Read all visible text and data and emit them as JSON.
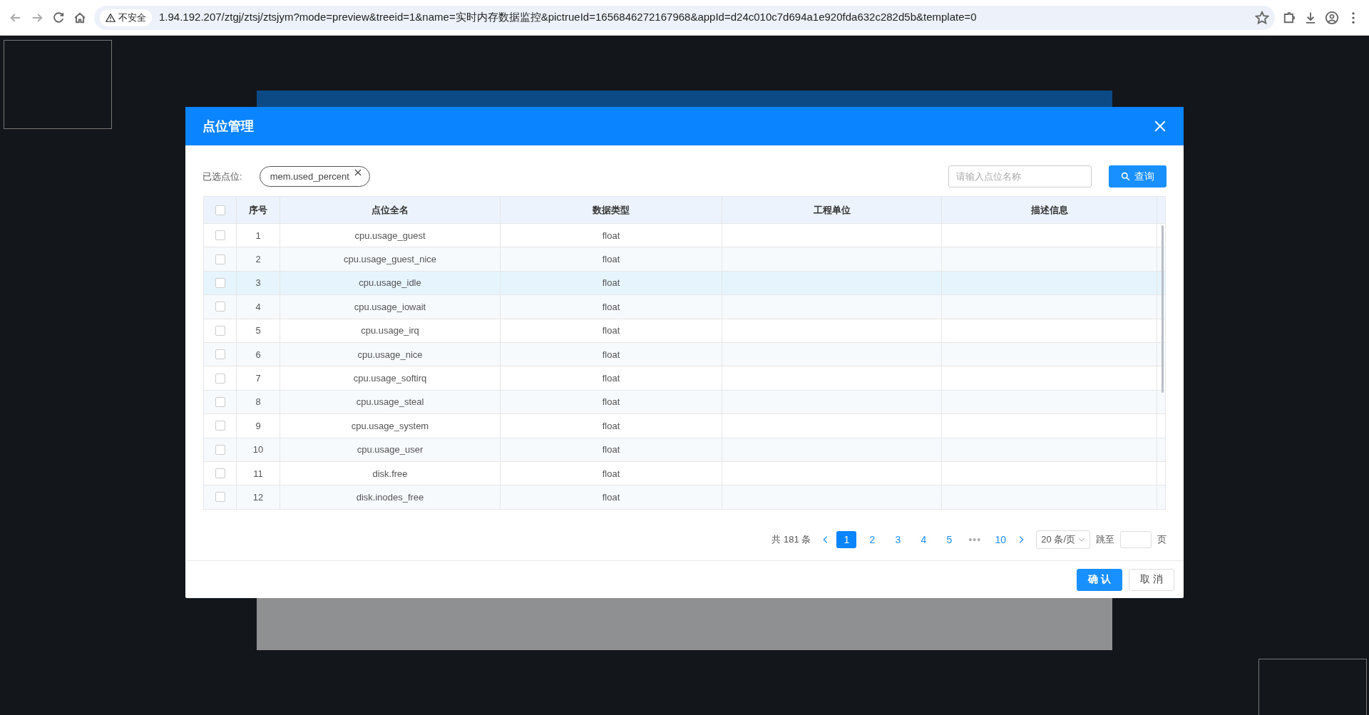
{
  "browser": {
    "security_label": "不安全",
    "url": "1.94.192.207/ztgj/ztsj/ztsjym?mode=preview&treeid=1&name=实时内存数据监控&pictrueId=1656846272167968&appId=d24c010c7d694a1e920fda632c282d5b&template=0"
  },
  "dialog": {
    "title": "点位管理",
    "selected_label": "已选点位:",
    "selected_tags": [
      {
        "label": "mem.used_percent"
      }
    ],
    "search": {
      "placeholder": "请输入点位名称"
    },
    "search_button": "查询",
    "table": {
      "all_checked": false,
      "columns": [
        "序号",
        "点位全名",
        "数据类型",
        "工程单位",
        "描述信息"
      ],
      "rows": [
        {
          "checked": false,
          "highlighted": false,
          "cells": [
            "1",
            "cpu.usage_guest",
            "float"
          ]
        },
        {
          "checked": false,
          "highlighted": false,
          "cells": [
            "2",
            "cpu.usage_guest_nice",
            "float"
          ]
        },
        {
          "checked": false,
          "highlighted": true,
          "cells": [
            "3",
            "cpu.usage_idle",
            "float"
          ]
        },
        {
          "checked": false,
          "highlighted": false,
          "cells": [
            "4",
            "cpu.usage_iowait",
            "float"
          ]
        },
        {
          "checked": false,
          "highlighted": false,
          "cells": [
            "5",
            "cpu.usage_irq",
            "float"
          ]
        },
        {
          "checked": false,
          "highlighted": false,
          "cells": [
            "6",
            "cpu.usage_nice",
            "float"
          ]
        },
        {
          "checked": false,
          "highlighted": false,
          "cells": [
            "7",
            "cpu.usage_softirq",
            "float"
          ]
        },
        {
          "checked": false,
          "highlighted": false,
          "cells": [
            "8",
            "cpu.usage_steal",
            "float"
          ]
        },
        {
          "checked": false,
          "highlighted": false,
          "cells": [
            "9",
            "cpu.usage_system",
            "float"
          ]
        },
        {
          "checked": false,
          "highlighted": false,
          "cells": [
            "10",
            "cpu.usage_user",
            "float"
          ]
        },
        {
          "checked": false,
          "highlighted": false,
          "cells": [
            "11",
            "disk.free",
            "float"
          ]
        },
        {
          "checked": false,
          "highlighted": false,
          "cells": [
            "12",
            "disk.inodes_free",
            "float"
          ]
        }
      ]
    },
    "pagination": {
      "total": "共 181 条",
      "pages": [
        {
          "label": "1",
          "selected": true
        },
        {
          "label": "2",
          "selected": false
        },
        {
          "label": "3",
          "selected": false
        },
        {
          "label": "4",
          "selected": false
        },
        {
          "label": "5",
          "selected": false
        },
        {
          "label": "•••",
          "selected": false
        },
        {
          "label": "10",
          "selected": false
        }
      ],
      "page_size": "20 条/页",
      "jump_label": "跳至",
      "page_suffix": "页"
    },
    "buttons": [
      {
        "kind": "primary",
        "label": "确 认"
      },
      {
        "kind": "default",
        "label": "取 消"
      }
    ]
  }
}
